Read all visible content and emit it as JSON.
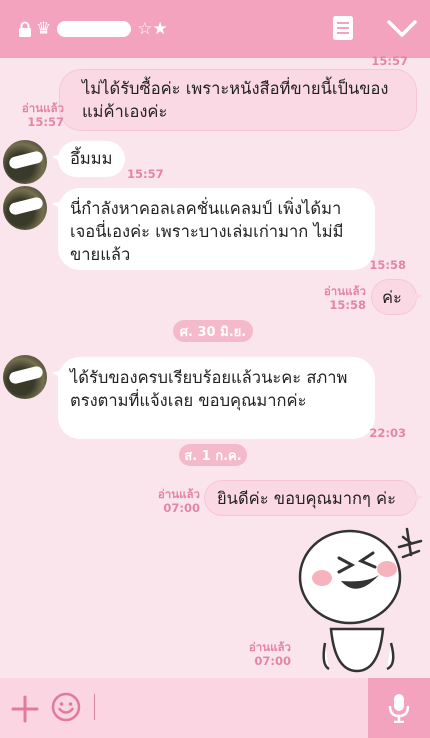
{
  "header": {
    "title_prefix": "♛",
    "title_suffix": "☆★"
  },
  "messages": [
    {
      "text": "ไม่ได้รับซื้อค่ะ เพราะหนังสือที่ขายนี้เป็นของแม่ค้าเองค่ะ",
      "read": "อ่านแล้ว",
      "time": "15:57",
      "time_top": "15:57"
    },
    {
      "text": "อึ้มมม",
      "time": "15:57"
    },
    {
      "text": "นี่กำลังหาคอลเลคชั่นแคลมป์ เพิ่งได้มาเจอนี่เองค่ะ เพราะบางเล่มเก่ามาก ไม่มีขายแล้ว",
      "time": "15:58"
    },
    {
      "text": "ค่ะ",
      "read": "อ่านแล้ว",
      "time": "15:58"
    },
    {
      "text": "ได้รับของครบเรียบร้อยแล้วนะคะ สภาพตรงตามที่แจ้งเลย ขอบคุณมากค่ะ",
      "time": "22:03"
    },
    {
      "text": "ยินดีค่ะ ขอบคุณมากๆ ค่ะ",
      "read": "อ่านแล้ว",
      "time": "07:00"
    },
    {
      "sticker": "laughing-face",
      "read": "อ่านแล้ว",
      "time": "07:00"
    }
  ],
  "dates": [
    "ศ. 30 มิ.ย.",
    "ส. 1 ก.ค."
  ],
  "colors": {
    "header": "#f3a3bd",
    "background": "#fbe5ec",
    "outgoing_bubble": "#fbd9e4",
    "meta_text": "#e386a6"
  },
  "icons": {
    "lock": "lock-icon",
    "notes": "notes-icon",
    "chevron": "chevron-down-icon",
    "plus": "plus-icon",
    "emoji": "smile-icon",
    "mic": "mic-icon"
  }
}
